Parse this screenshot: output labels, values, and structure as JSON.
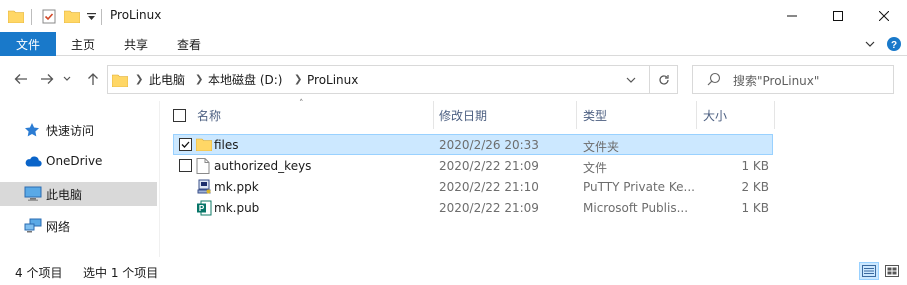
{
  "window": {
    "title": "ProLinux",
    "controls": [
      "minimize",
      "maximize",
      "close"
    ]
  },
  "ribbon": {
    "tabs": [
      {
        "label": "文件",
        "active": true
      },
      {
        "label": "主页",
        "active": false
      },
      {
        "label": "共享",
        "active": false
      },
      {
        "label": "查看",
        "active": false
      }
    ]
  },
  "address": {
    "breadcrumbs": [
      "此电脑",
      "本地磁盘 (D:)",
      "ProLinux"
    ]
  },
  "search": {
    "placeholder": "搜索\"ProLinux\""
  },
  "sidebar": {
    "items": [
      {
        "label": "快速访问",
        "icon": "star-icon",
        "selected": false
      },
      {
        "label": "OneDrive",
        "icon": "cloud-icon",
        "selected": false
      },
      {
        "label": "此电脑",
        "icon": "computer-icon",
        "selected": true
      },
      {
        "label": "网络",
        "icon": "network-icon",
        "selected": false
      }
    ]
  },
  "columns": {
    "name": "名称",
    "modified": "修改日期",
    "type": "类型",
    "size": "大小"
  },
  "files": [
    {
      "name": "files",
      "modified": "2020/2/26 20:33",
      "type": "文件夹",
      "size": "",
      "icon": "folder-icon",
      "selected": true,
      "checkbox": true,
      "checked": true
    },
    {
      "name": "authorized_keys",
      "modified": "2020/2/22 21:09",
      "type": "文件",
      "size": "1 KB",
      "icon": "file-icon",
      "selected": false,
      "checkbox": true,
      "checked": false
    },
    {
      "name": "mk.ppk",
      "modified": "2020/2/22 21:10",
      "type": "PuTTY Private Ke...",
      "size": "2 KB",
      "icon": "putty-key-icon",
      "selected": false,
      "checkbox": false,
      "checked": false
    },
    {
      "name": "mk.pub",
      "modified": "2020/2/22 21:09",
      "type": "Microsoft Publis...",
      "size": "1 KB",
      "icon": "publisher-icon",
      "selected": false,
      "checkbox": false,
      "checked": false
    }
  ],
  "status": {
    "item_count": "4 个项目",
    "selected_count": "选中 1 个项目"
  },
  "colors": {
    "accent": "#1979ca",
    "selection": "#cce8ff",
    "selection_border": "#99d1ff",
    "folder": "#ffd766"
  }
}
